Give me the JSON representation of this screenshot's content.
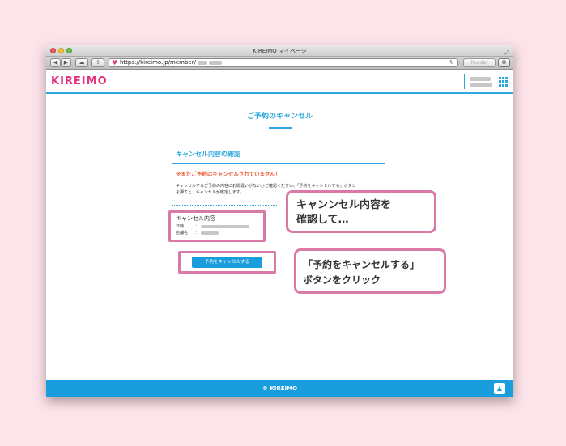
{
  "browser": {
    "title": "KIREIMO マイページ",
    "url_visible": "https://kireimo.jp/member/",
    "reader_label": "Reader",
    "nav_back": "◀",
    "nav_forward": "▶"
  },
  "site": {
    "logo": "KIREIMO",
    "page_title": "ご予約のキャンセル",
    "section_heading": "キャンセル内容の確認",
    "warning": "※まだご予約はキャンセルされていません！",
    "description_line1": "キャンセルするご予約の内容にお間違いがないかご確認ください。「予約をキャンセルする」ボタン",
    "description_line2": "を押すと、キャンセルが確定します。",
    "detail_title": "キャンセル内容",
    "detail_rows": [
      {
        "label": "日時",
        "separator": "："
      },
      {
        "label": "店舗名",
        "separator": "："
      }
    ],
    "cancel_button_label": "予約をキャンセルする",
    "footer": "© KIREIMO",
    "scroll_top_icon": "^"
  },
  "callouts": {
    "confirm": {
      "line1": "キャンンセル内容を",
      "line2": "確認して…"
    },
    "click": {
      "line1": "「予約をキャンセルする」",
      "line2": "ボタンをクリック"
    }
  },
  "colors": {
    "accent": "#2aa7dc",
    "brand": "#e4317f",
    "highlight": "#d97aa6",
    "warning": "#ee5a36",
    "background": "#fde4ea"
  }
}
